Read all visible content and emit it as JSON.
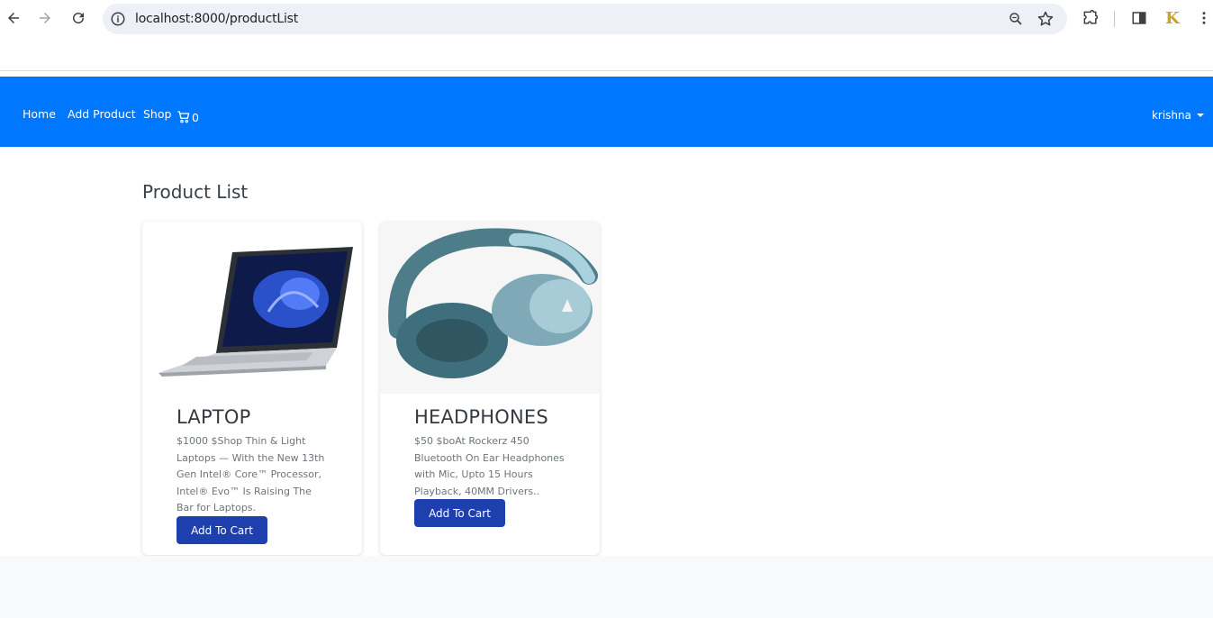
{
  "browser": {
    "url": "localhost:8000/productList"
  },
  "navbar": {
    "links": [
      "Home",
      "Add Product",
      "Shop"
    ],
    "cart_count": "0",
    "user": "krishna",
    "bg_color": "#0077ff"
  },
  "page": {
    "title": "Product List"
  },
  "products": [
    {
      "name": "LAPTOP",
      "description": "$1000 $Shop Thin & Light Laptops — With the New 13th Gen Intel® Core™ Processor, Intel® Evo™ Is Raising The Bar for Laptops.",
      "button_label": "Add To Cart"
    },
    {
      "name": "HEADPHONES",
      "description": "$50 $boAt Rockerz 450 Bluetooth On Ear Headphones with Mic, Upto 15 Hours Playback, 40MM Drivers..",
      "button_label": "Add To Cart"
    }
  ],
  "colors": {
    "button": "#1e3fae",
    "navbar": "#0077ff"
  }
}
